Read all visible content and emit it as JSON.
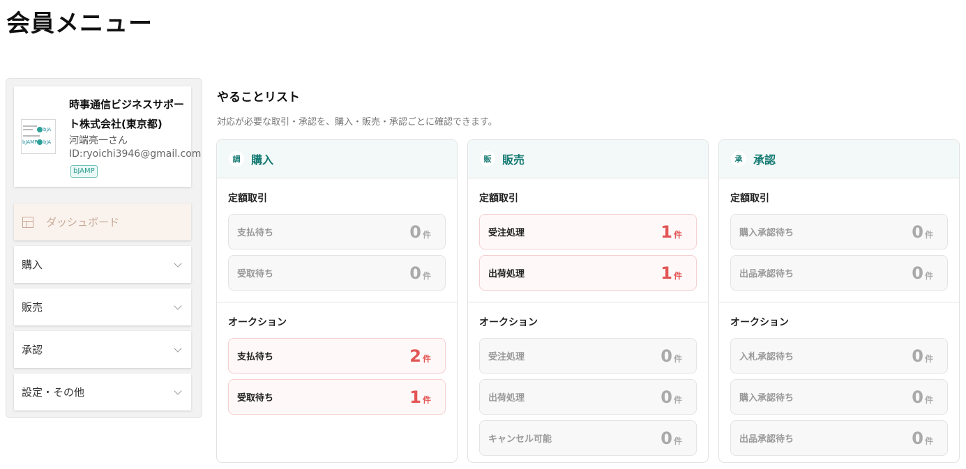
{
  "page_title": "会員メニュー",
  "profile": {
    "company": "時事通信ビジネスサポート株式会社(東京都)",
    "name": "河端亮一さん",
    "id": "ID:ryoichi3946@gmail.com",
    "badge": "bJAMP",
    "logo_text_1": "bJA",
    "logo_text_2": "bJAMP",
    "logo_text_3": "bJA"
  },
  "nav": {
    "dashboard": "ダッシュボード",
    "purchase": "購入",
    "sales": "販売",
    "approval": "承認",
    "settings": "設定・その他"
  },
  "todo": {
    "title": "やることリスト",
    "description": "対応が必要な取引・承認を、購入・販売・承認ごとに確認できます。",
    "unit": "件",
    "columns": [
      {
        "icon": "調",
        "title": "購入",
        "sections": [
          {
            "title": "定額取引",
            "items": [
              {
                "label": "支払待ち",
                "count": "0"
              },
              {
                "label": "受取待ち",
                "count": "0"
              }
            ]
          },
          {
            "title": "オークション",
            "items": [
              {
                "label": "支払待ち",
                "count": "2"
              },
              {
                "label": "受取待ち",
                "count": "1"
              }
            ]
          }
        ]
      },
      {
        "icon": "販",
        "title": "販売",
        "sections": [
          {
            "title": "定額取引",
            "items": [
              {
                "label": "受注処理",
                "count": "1"
              },
              {
                "label": "出荷処理",
                "count": "1"
              }
            ]
          },
          {
            "title": "オークション",
            "items": [
              {
                "label": "受注処理",
                "count": "0"
              },
              {
                "label": "出荷処理",
                "count": "0"
              },
              {
                "label": "キャンセル可能",
                "count": "0"
              }
            ]
          }
        ]
      },
      {
        "icon": "承",
        "title": "承認",
        "sections": [
          {
            "title": "定額取引",
            "items": [
              {
                "label": "購入承認待ち",
                "count": "0"
              },
              {
                "label": "出品承認待ち",
                "count": "0"
              }
            ]
          },
          {
            "title": "オークション",
            "items": [
              {
                "label": "入札承認待ち",
                "count": "0"
              },
              {
                "label": "購入承認待ち",
                "count": "0"
              },
              {
                "label": "出品承認待ち",
                "count": "0"
              }
            ]
          }
        ]
      }
    ]
  },
  "colors": {
    "accent": "#137a72",
    "alert": "#e35555",
    "dashboard_bg": "#faf3ed"
  },
  "icons": {
    "dashboard": "layout-icon",
    "expand": "chevron-down-icon"
  }
}
